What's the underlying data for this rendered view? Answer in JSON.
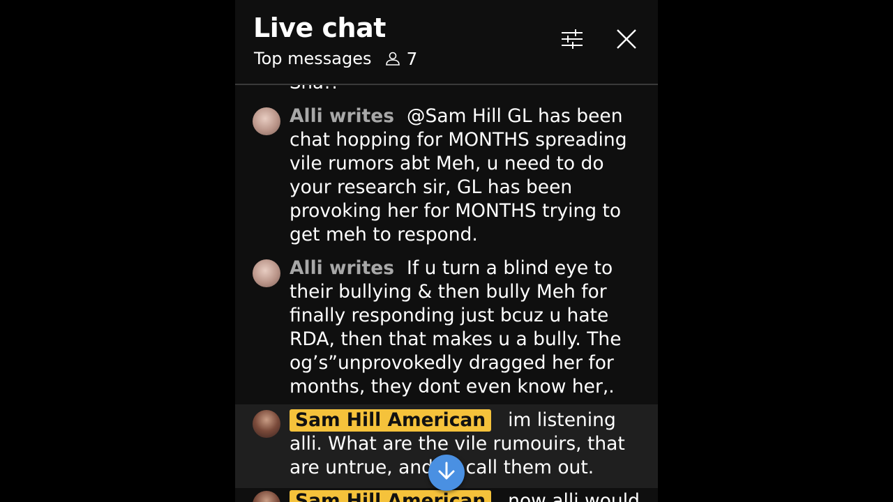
{
  "header": {
    "title": "Live chat",
    "subtitle": "Top messages",
    "viewer_count": "7",
    "icons": {
      "viewers": "person-icon",
      "filter": "sliders-icon",
      "close": "close-icon"
    }
  },
  "feed": {
    "cut_off_top_text": "Sha!!",
    "messages": [
      {
        "author": "Alli writes",
        "text": "@Sam Hill GL has been chat hopping for MONTHS spreading vile rumors abt Meh, u need to do your research sir, GL has been provoking her for MONTHS trying to get meh to respond."
      },
      {
        "author": "Alli writes",
        "text": "If u turn a blind eye to their bullying & then bully Meh for finally responding just bcuz u hate RDA, then that makes u a bully. The og’s”unprovokedly dragged her for months, they dont even know her,."
      },
      {
        "author": "Sam Hill American",
        "text": "im listening alli. What are the vile rumouirs, that are untrue, and I'll call them out."
      },
      {
        "author": "Sam Hill American",
        "text": "now alli would"
      }
    ]
  },
  "scroll_button": {
    "icon": "arrow-down-icon"
  },
  "colors": {
    "background": "#0f0f0f",
    "author_badge": "#f5c23b",
    "scroll_button": "#4a90e2",
    "author_text": "#a8a8a8"
  }
}
